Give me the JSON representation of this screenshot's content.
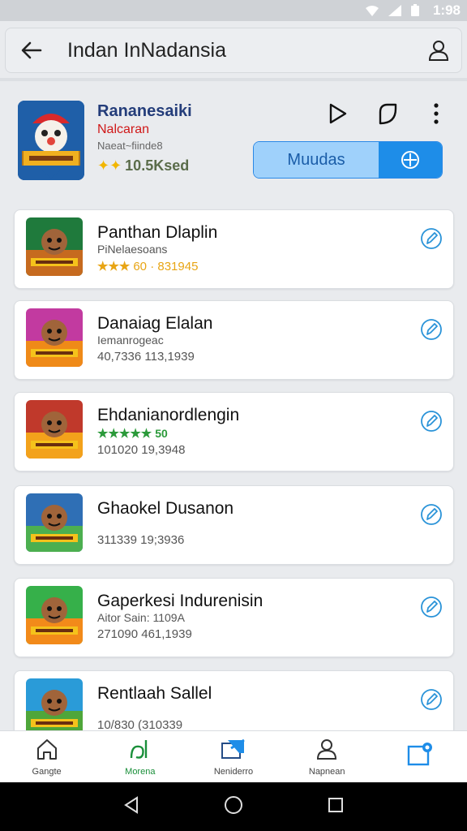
{
  "status_bar": {
    "time": "1:98"
  },
  "header": {
    "title": "Indan InNadansia"
  },
  "featured": {
    "name": "Rananesaiki",
    "subtitle": "Nalcaran",
    "meta": "Naeat~fiinde8",
    "rating": "10.5Ksed",
    "rating_icon": "double-star-icon",
    "install_label": "Muudas"
  },
  "list": [
    {
      "title": "Panthan Dlaplin",
      "line2": "PiNelaesoans",
      "stars": "★★★",
      "line3": "60 · 831945",
      "star_color": "#e8a515",
      "thumb": [
        "#1f7a3c",
        "#c66a1f"
      ]
    },
    {
      "title": "Danaiag Elalan",
      "line2": "Iemanrogeac",
      "stars": "",
      "line3": "40,7336 113,1939",
      "star_color": "",
      "thumb": [
        "#c23aa0",
        "#ef8a18"
      ]
    },
    {
      "title": "Ehdanianordlengin",
      "line2": "",
      "stars": "★★★★★",
      "line3": "50",
      "line4": "101020 19,3948",
      "star_color": "#2b9a3a",
      "thumb": [
        "#c0392b",
        "#f3a21b"
      ]
    },
    {
      "title": "Ghaokel Dusanon",
      "line2": "",
      "stars": "",
      "line3": "311339 19;3936",
      "star_color": "",
      "thumb": [
        "#2f6fb5",
        "#4caf50"
      ]
    },
    {
      "title": "Gaperkesi Indurenisin",
      "line2": "Aitor Sain: 1109A",
      "stars": "",
      "line3": "271090 461,1939",
      "star_color": "",
      "thumb": [
        "#36b04a",
        "#f28a1a"
      ]
    },
    {
      "title": "Rentlaah Sallel",
      "line2": "",
      "stars": "",
      "line3": "10/830 (310339",
      "star_color": "",
      "thumb": [
        "#2a9bd8",
        "#4fa63a"
      ]
    }
  ],
  "bottom_nav": [
    {
      "label": "Gangte",
      "icon": "home-icon"
    },
    {
      "label": "Morena",
      "icon": "leaf-icon",
      "active": true
    },
    {
      "label": "Neniderro",
      "icon": "folder-icon"
    },
    {
      "label": "Napnean",
      "icon": "person-icon"
    },
    {
      "label": "",
      "icon": "notification-icon"
    }
  ],
  "colors": {
    "accent": "#1e8de8",
    "brand_green": "#1a8f3a",
    "star": "#e8a515"
  }
}
